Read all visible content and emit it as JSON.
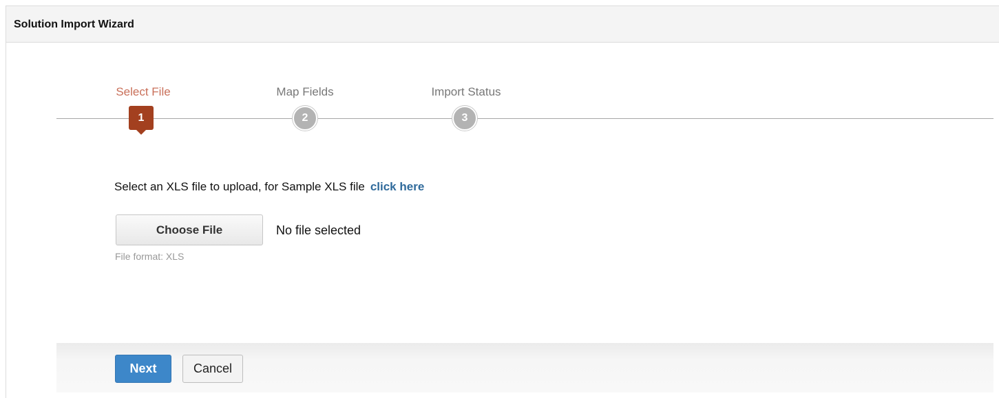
{
  "header": {
    "title": "Solution Import Wizard"
  },
  "steps": [
    {
      "label": "Select File",
      "number": "1",
      "state": "active"
    },
    {
      "label": "Map Fields",
      "number": "2",
      "state": "inactive"
    },
    {
      "label": "Import Status",
      "number": "3",
      "state": "inactive"
    }
  ],
  "upload": {
    "prompt": "Select an XLS file to upload, for Sample XLS file",
    "sample_link": "click here",
    "choose_button": "Choose File",
    "file_status": "No file selected",
    "format_hint": "File format: XLS"
  },
  "footer": {
    "next_label": "Next",
    "cancel_label": "Cancel"
  },
  "colors": {
    "active_step": "#a3401f",
    "active_step_label": "#c9705a",
    "inactive_step": "#b3b3b3",
    "link": "#2f6a9b",
    "primary_button": "#3d87c9"
  }
}
